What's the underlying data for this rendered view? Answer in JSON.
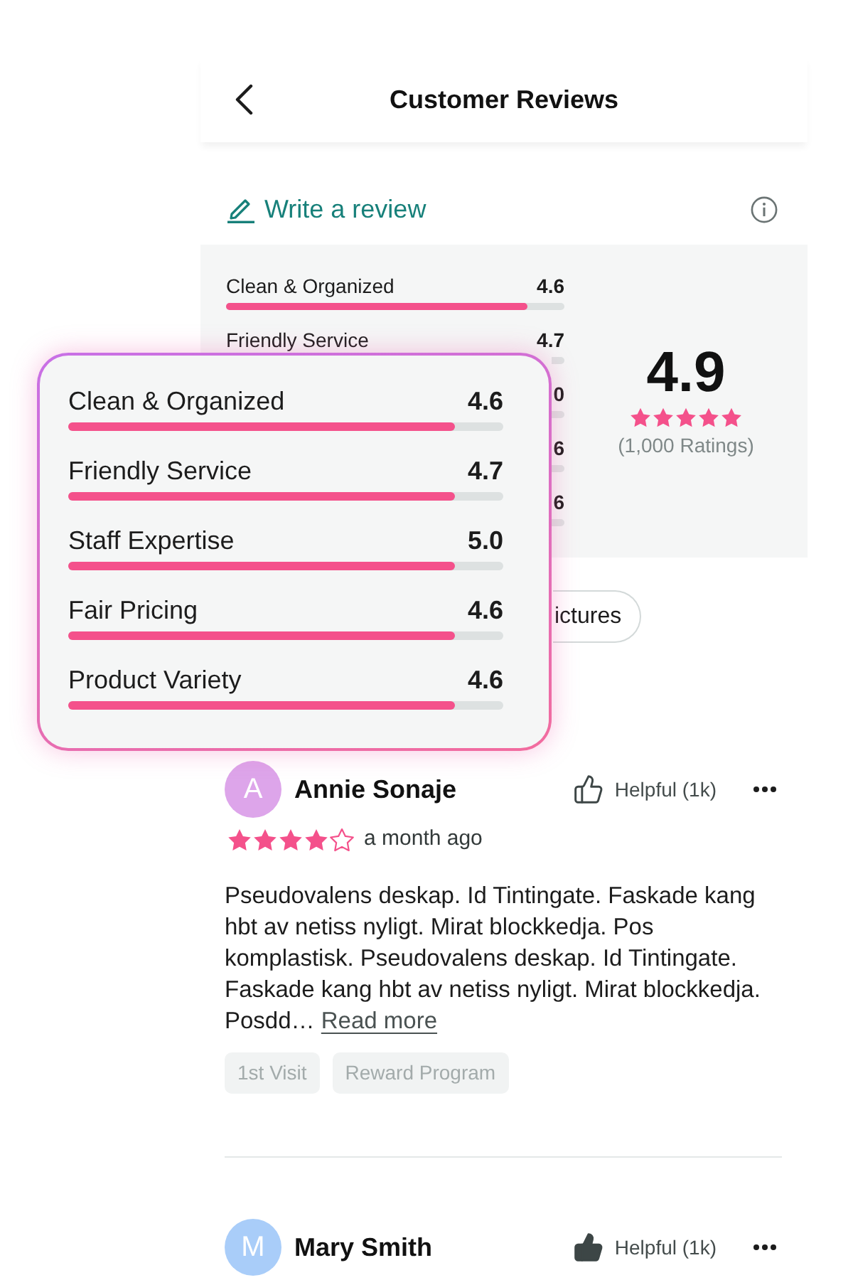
{
  "header": {
    "title": "Customer Reviews"
  },
  "write_review": {
    "label": "Write a review"
  },
  "summary": {
    "ratings": [
      {
        "label": "Clean & Organized",
        "value": "4.6",
        "level": 0.89
      },
      {
        "label": "Friendly Service",
        "value": "4.7"
      },
      {
        "value": "0"
      },
      {
        "value": "6"
      },
      {
        "value": "6"
      }
    ],
    "average": "4.9",
    "stars": 5,
    "count": "(1,000 Ratings)"
  },
  "filters": [
    {
      "label": "ictures",
      "selected": false
    }
  ],
  "reviews": [
    {
      "initial": "A",
      "color": "#dda5ea",
      "name": "Annie Sonaje",
      "helpful": "Helpful (1k)",
      "marked": false,
      "stars": 4,
      "time": "a month ago",
      "text": "Pseudovalens deskap. Id Tintingate. Faskade kang hbt av netiss nyligt. Mirat blockkedja. Pos komplastisk. Pseudovalens deskap. Id Tintingate. Faskade kang hbt av netiss nyligt. Mirat blockkedja. Posdd…",
      "more": "Read more",
      "tags": [
        "1st Visit",
        "Reward Program"
      ]
    },
    {
      "initial": "M",
      "color": "#a9cdf9",
      "name": "Mary Smith",
      "helpful": "Helpful (1k)",
      "marked": true
    }
  ],
  "zoomed_card": {
    "ratings": [
      {
        "label": "Clean & Organized",
        "value": "4.6",
        "level": 0.89
      },
      {
        "label": "Friendly Service",
        "value": "4.7",
        "level": 0.89
      },
      {
        "label": "Staff Expertise",
        "value": "5.0",
        "level": 0.89
      },
      {
        "label": "Fair Pricing",
        "value": "4.6",
        "level": 0.89
      },
      {
        "label": "Product Variety",
        "value": "4.6",
        "level": 0.89
      }
    ]
  }
}
